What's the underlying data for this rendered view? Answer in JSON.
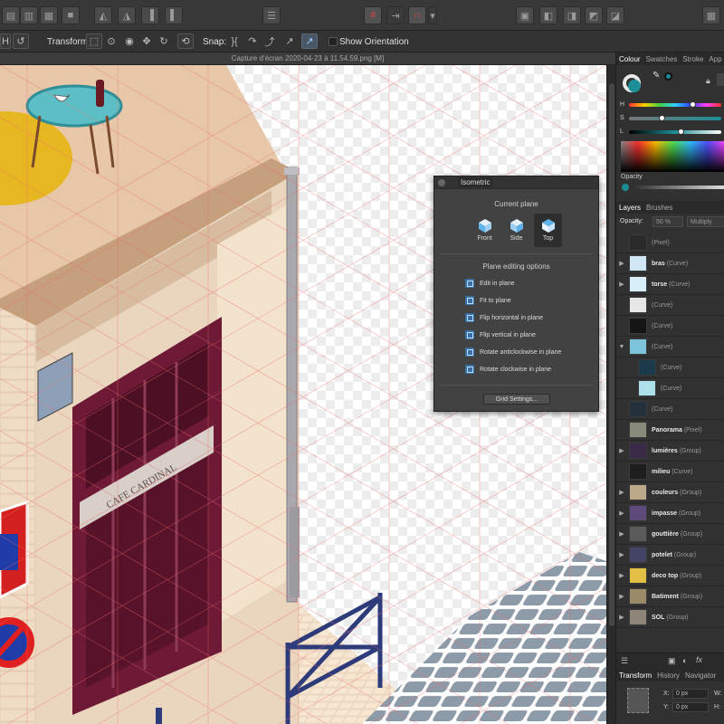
{
  "document": {
    "title": "Capture d’écran 2020-04-23 à 11.54.59.png [M]"
  },
  "context_toolbar": {
    "transform_label": "Transform:",
    "snap_label": "Snap:",
    "show_orientation_label": "Show Orientation"
  },
  "isometric_panel": {
    "title": "Isometric",
    "current_plane_label": "Current plane",
    "planes": [
      {
        "label": "Front",
        "active": false
      },
      {
        "label": "Side",
        "active": false
      },
      {
        "label": "Top",
        "active": true
      }
    ],
    "plane_editing_label": "Plane editing options",
    "options": [
      "Edit in plane",
      "Fit to plane",
      "Flip horizontal in plane",
      "Flip vertical in plane",
      "Rotate anticlockwise in plane",
      "Rotate clockwise in plane"
    ],
    "grid_settings_label": "Grid Settings..."
  },
  "colour_panel": {
    "tabs": [
      "Colour",
      "Swatches",
      "Stroke",
      "App"
    ],
    "active_tab": "Colour",
    "h_label": "H",
    "s_label": "S",
    "l_label": "L",
    "opacity_label": "Opacity",
    "fill_color": "#1d8e96",
    "h_level": 0.7,
    "s_level": 0.36,
    "l_level": 0.57
  },
  "layers_panel": {
    "tabs": [
      "Layers",
      "Brushes"
    ],
    "active_tab": "Layers",
    "opacity_label": "Opacity:",
    "opacity_value": "50 %",
    "blend_mode": "Multiply",
    "layers": [
      {
        "name": "",
        "type": "(Pixel)",
        "expander": ""
      },
      {
        "name": "bras",
        "type": "(Curve)",
        "expander": "▶"
      },
      {
        "name": "torse",
        "type": "(Curve)",
        "expander": "▶"
      },
      {
        "name": "",
        "type": "(Curve)",
        "expander": ""
      },
      {
        "name": "",
        "type": "(Curve)",
        "expander": ""
      },
      {
        "name": "",
        "type": "(Curve)",
        "expander": "▼"
      },
      {
        "name": "",
        "type": "(Curve)",
        "expander": "",
        "indent": true
      },
      {
        "name": "",
        "type": "(Curve)",
        "expander": "",
        "indent": true
      },
      {
        "name": "",
        "type": "(Curve)",
        "expander": ""
      },
      {
        "name": "Panorama",
        "type": "(Pixel)",
        "expander": ""
      },
      {
        "name": "lumières",
        "type": "(Group)",
        "expander": "▶"
      },
      {
        "name": "milieu",
        "type": "(Curve)",
        "expander": ""
      },
      {
        "name": "couleurs",
        "type": "(Group)",
        "expander": "▶"
      },
      {
        "name": "impasse",
        "type": "(Group)",
        "expander": "▶"
      },
      {
        "name": "gouttière",
        "type": "(Group)",
        "expander": "▶"
      },
      {
        "name": "potelet",
        "type": "(Group)",
        "expander": "▶"
      },
      {
        "name": "deco top",
        "type": "(Group)",
        "expander": "▶"
      },
      {
        "name": "Batiment",
        "type": "(Group)",
        "expander": "▶"
      },
      {
        "name": "SOL",
        "type": "(Group)",
        "expander": "▶"
      }
    ]
  },
  "transform_panel": {
    "tabs": [
      "Transform",
      "History",
      "Navigator"
    ],
    "active_tab": "Transform",
    "x_label": "X:",
    "y_label": "Y:",
    "x_value": "0 px",
    "y_value": "0 px",
    "w_label": "W:",
    "h_label": "H:"
  },
  "artwork": {
    "shop_sign": "CAFE CARDINAL"
  }
}
